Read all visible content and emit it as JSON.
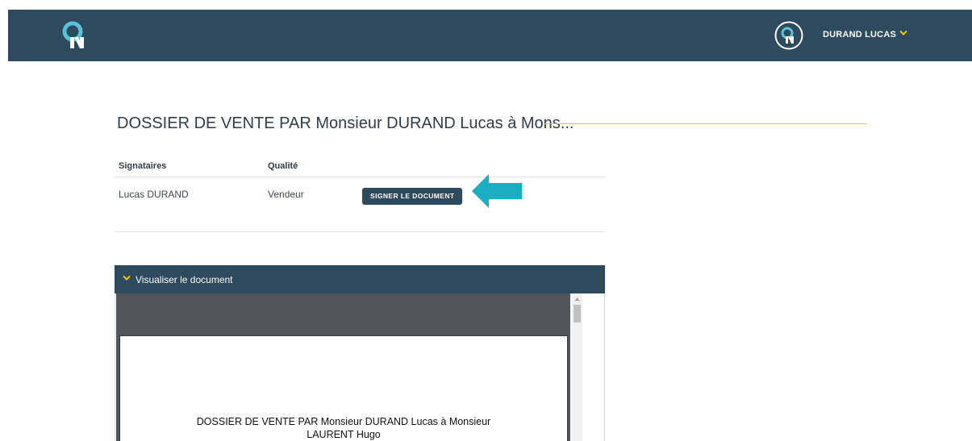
{
  "header": {
    "logo": "qn-logo-icon",
    "avatar": "qn-avatar-icon",
    "user_name": "DURAND LUCAS",
    "chevron": "chevron-down-icon",
    "colors": {
      "bar": "#2e4a5e",
      "accent": "#f5c400",
      "logo_blue": "#5bc0d8"
    }
  },
  "document": {
    "title": "DOSSIER DE VENTE PAR Monsieur DURAND Lucas à Mons...",
    "rule_color": "#e8c940"
  },
  "signers": {
    "headers": {
      "name": "Signataires",
      "role": "Qualité"
    },
    "rows": [
      {
        "name": "Lucas DURAND",
        "role": "Vendeur",
        "action": "SIGNER LE DOCUMENT"
      }
    ],
    "arrow_color": "#1aaec2"
  },
  "viewer": {
    "label": "Visualiser le document",
    "chevron": "chevron-down-icon",
    "page_text_line1": "DOSSIER DE VENTE PAR Monsieur DURAND Lucas à Monsieur",
    "page_text_line2": "LAURENT Hugo"
  }
}
